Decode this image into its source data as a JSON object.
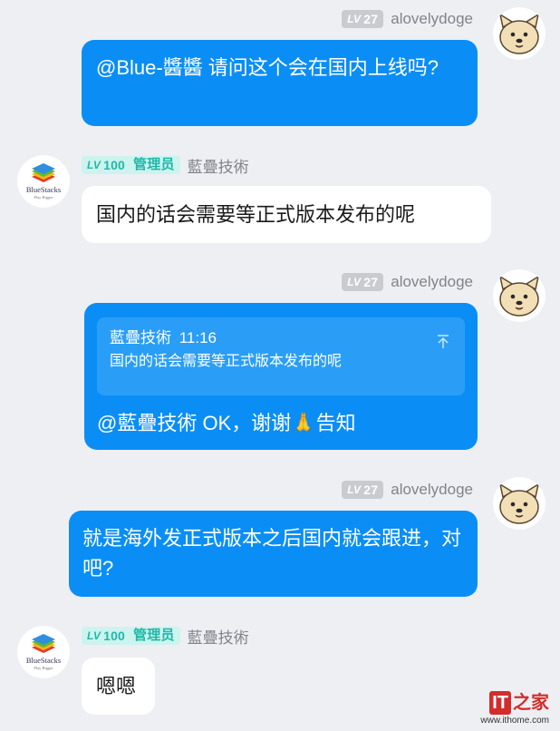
{
  "users": {
    "dog": {
      "level_tag": "LV",
      "level_num": "27",
      "name": "alovelydoge"
    },
    "bs": {
      "level_tag": "LV",
      "level_num": "100",
      "role": "管理员",
      "name": "藍疊技術",
      "logo_text": "BlueStacks",
      "logo_sub": "Play Bigger"
    }
  },
  "messages": {
    "m1": {
      "text": "@Blue-醬醬 请问这个会在国内上线吗?"
    },
    "m2": {
      "text": "国内的话会需要等正式版本发布的呢"
    },
    "m3": {
      "quote_author": "藍疊技術",
      "quote_time": "11:16",
      "quote_text": "国内的话会需要等正式版本发布的呢",
      "text": "@藍疊技術 OK，谢谢🙏告知"
    },
    "m4": {
      "text": "就是海外发正式版本之后国内就会跟进，对吧?"
    },
    "m5": {
      "text": "嗯嗯"
    }
  },
  "watermark": {
    "logo_left": "IT",
    "logo_right": "之家",
    "url": "www.ithome.com"
  },
  "colors": {
    "bubble_blue": "#0a8ef6",
    "quote_blue": "#2a9ef7",
    "admin_teal": "#1fb8a7",
    "background": "#eeeff3"
  },
  "icons": [
    "dog-avatar-icon",
    "bluestacks-logo-icon",
    "pin-icon"
  ]
}
